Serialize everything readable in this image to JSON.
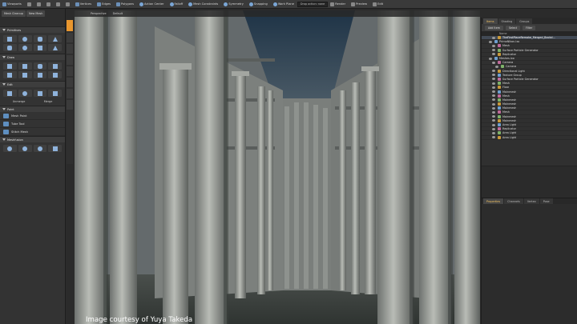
{
  "toolbar": {
    "layout_label": "Viewports",
    "mode_buttons": [
      "Vertices",
      "Edges",
      "Polygons"
    ],
    "action_center": "Action Center",
    "falloff": "Falloff",
    "mesh_constraints": "Mesh Constraints",
    "symmetry": "Symmetry",
    "snapping": "Snapping",
    "work_plane": "Work Plane",
    "drop_action": "Drop action: none",
    "render": "Render",
    "preview": "Preview",
    "edit": "Edit"
  },
  "left_panel": {
    "tab_buttons": [
      "Mesh Cleanup",
      "New Mesh"
    ],
    "sections": {
      "primitives": "Primitives",
      "draw": "Draw",
      "edit": "Edit",
      "paint": "Paint",
      "meshfusion": "Meshfusion"
    },
    "edit_pair": [
      "Unmerge",
      "Merge"
    ],
    "paint_items": [
      "Mesh Paint",
      "Tube Tool",
      "Stitch Mesh"
    ]
  },
  "viewport": {
    "view_mode": "Perspective",
    "shading": "Default",
    "credit": "Image courtesy of Yuya Takeda"
  },
  "right_panel": {
    "tabs": [
      "Items",
      "Shading",
      "Groups"
    ],
    "toolbar_buttons": [
      "Add Item",
      "Select",
      "Filter"
    ],
    "column_header": "Name",
    "items": [
      "TheFirstPlaceRemake_Merged_Backd...",
      "PrimaNIkon.lxo",
      "Mesh",
      "Surface Particle Generator",
      "Replicator",
      "Meshes.lxo",
      "Camera",
      "Camera",
      "Directional Light",
      "Texture Group",
      "Surface Particle Generator",
      "Mesh",
      "Floor",
      "Mainmesh",
      "Mesh",
      "Mainmesh",
      "Mainmesh",
      "Mainmesh",
      "Mesh",
      "Mainmesh",
      "Mainmesh",
      "Area Light",
      "Replicator",
      "Area Light",
      "Area Light"
    ],
    "bottom_tabs": [
      "Properties",
      "Channels",
      "Vertex",
      "Pose"
    ]
  },
  "colors": {
    "accent": "#e8962e",
    "selection": "#424a55",
    "panel": "#303030"
  }
}
